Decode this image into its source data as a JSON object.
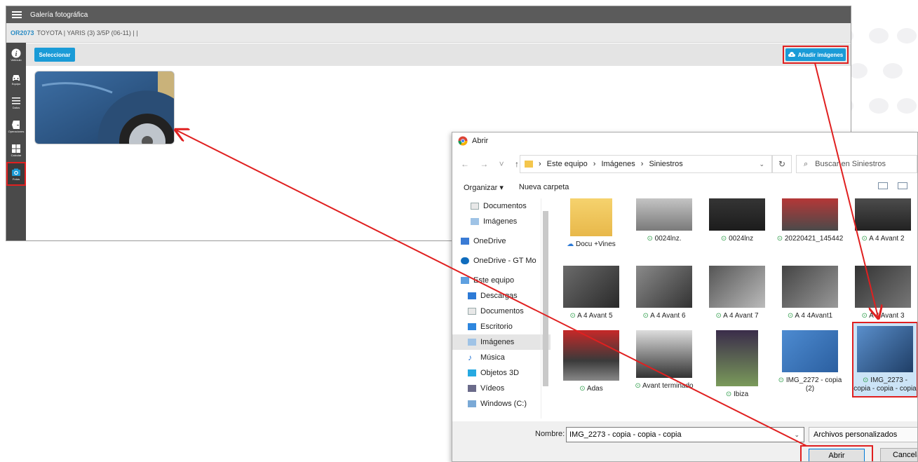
{
  "app": {
    "title": "Galería fotográfica",
    "vehicle_code": "OR2073",
    "vehicle_desc": "TOYOTA | YARIS (3) 3/5P (06-11) | |",
    "select_button": "Seleccionar",
    "add_images_button": "Añadir imágenes",
    "sidebar": [
      {
        "label": "Vehículo",
        "icon": "info-icon"
      },
      {
        "label": "Equipo",
        "icon": "car-icon"
      },
      {
        "label": "Datos",
        "icon": "list-icon"
      },
      {
        "label": "Operaciones",
        "icon": "door-icon"
      },
      {
        "label": "Calcular",
        "icon": "calculator-icon"
      },
      {
        "label": "Fotos",
        "icon": "camera-icon"
      }
    ]
  },
  "dialog": {
    "title": "Abrir",
    "breadcrumb": [
      "Este equipo",
      "Imágenes",
      "Siniestros"
    ],
    "search_placeholder": "Buscar en Siniestros",
    "organize": "Organizar ▾",
    "new_folder": "Nueva carpeta",
    "nav_items": [
      {
        "label": "Documentos",
        "icon": "documents-icon"
      },
      {
        "label": "Imágenes",
        "icon": "pictures-icon"
      },
      {
        "label": "OneDrive",
        "icon": "onedrive-icon"
      },
      {
        "label": "OneDrive - GT Mo",
        "icon": "onedrive-icon"
      },
      {
        "label": "Este equipo",
        "icon": "computer-icon"
      },
      {
        "label": "Descargas",
        "icon": "downloads-icon"
      },
      {
        "label": "Documentos",
        "icon": "documents-icon"
      },
      {
        "label": "Escritorio",
        "icon": "desktop-icon"
      },
      {
        "label": "Imágenes",
        "icon": "pictures-icon"
      },
      {
        "label": "Música",
        "icon": "music-icon"
      },
      {
        "label": "Objetos 3D",
        "icon": "objects3d-icon"
      },
      {
        "label": "Vídeos",
        "icon": "videos-icon"
      },
      {
        "label": "Windows  (C:)",
        "icon": "drive-icon"
      }
    ],
    "files": [
      {
        "label": "Docu +Vines",
        "status": "cloud"
      },
      {
        "label": "0024lnz.",
        "status": "synced"
      },
      {
        "label": "0024lnz",
        "status": "synced"
      },
      {
        "label": "20220421_145442",
        "status": "synced"
      },
      {
        "label": "A 4 Avant 2",
        "status": "synced"
      },
      {
        "label": "A 4 Avant 5",
        "status": "synced"
      },
      {
        "label": "A 4 Avant 6",
        "status": "synced"
      },
      {
        "label": "A 4 Avant 7",
        "status": "synced"
      },
      {
        "label": "A 4 4Avant1",
        "status": "synced"
      },
      {
        "label": "A 4 Avant 3",
        "status": "synced"
      },
      {
        "label": "Adas",
        "status": "synced"
      },
      {
        "label": "Avant terminado",
        "status": "synced"
      },
      {
        "label": "Ibiza",
        "status": "synced"
      },
      {
        "label": "IMG_2272 - copia (2)",
        "status": "synced"
      },
      {
        "label": "IMG_2273 - copia - copia - copia",
        "status": "synced"
      }
    ],
    "filename_label": "Nombre:",
    "filename_value": "IMG_2273 - copia - copia - copia",
    "filetype": "Archivos personalizados",
    "open_button": "Abrir",
    "cancel_button": "Cancelar"
  },
  "colors": {
    "accent": "#1a9bd7",
    "highlight": "#e02020",
    "sidebar": "#4a4a4a",
    "header": "#5b5b5b"
  }
}
